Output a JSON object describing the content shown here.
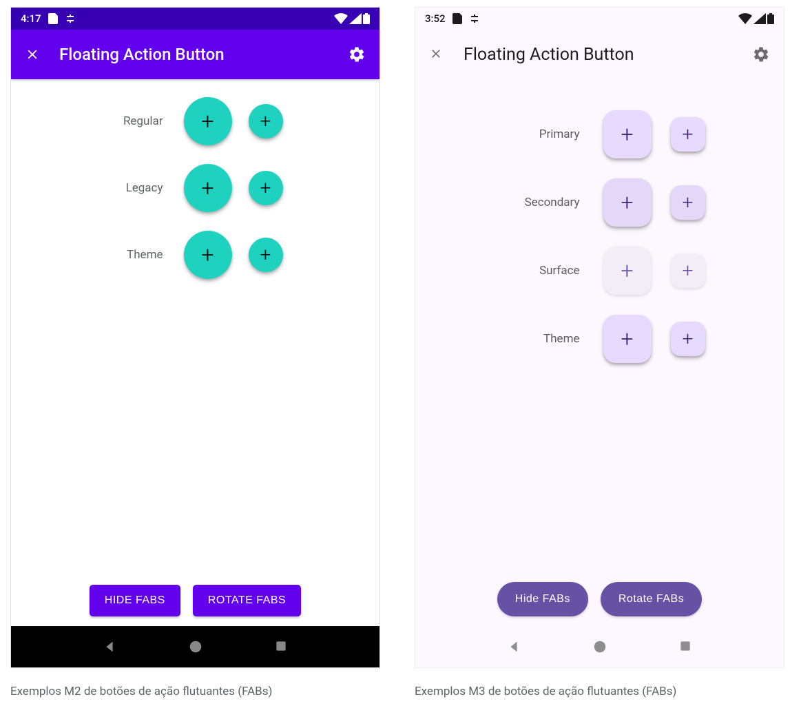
{
  "m2": {
    "status": {
      "time": "4:17"
    },
    "app_bar": {
      "title": "Floating Action Button"
    },
    "rows": [
      {
        "label": "Regular"
      },
      {
        "label": "Legacy"
      },
      {
        "label": "Theme"
      }
    ],
    "buttons": {
      "hide": "HIDE FABS",
      "rotate": "ROTATE FABS"
    },
    "caption": "Exemplos M2 de botões de ação flutuantes (FABs)"
  },
  "m3": {
    "status": {
      "time": "3:52"
    },
    "app_bar": {
      "title": "Floating Action Button"
    },
    "rows": [
      {
        "label": "Primary"
      },
      {
        "label": "Secondary"
      },
      {
        "label": "Surface"
      },
      {
        "label": "Theme"
      }
    ],
    "buttons": {
      "hide": "Hide FABs",
      "rotate": "Rotate FABs"
    },
    "caption": "Exemplos M3 de botões de ação flutuantes (FABs)"
  }
}
